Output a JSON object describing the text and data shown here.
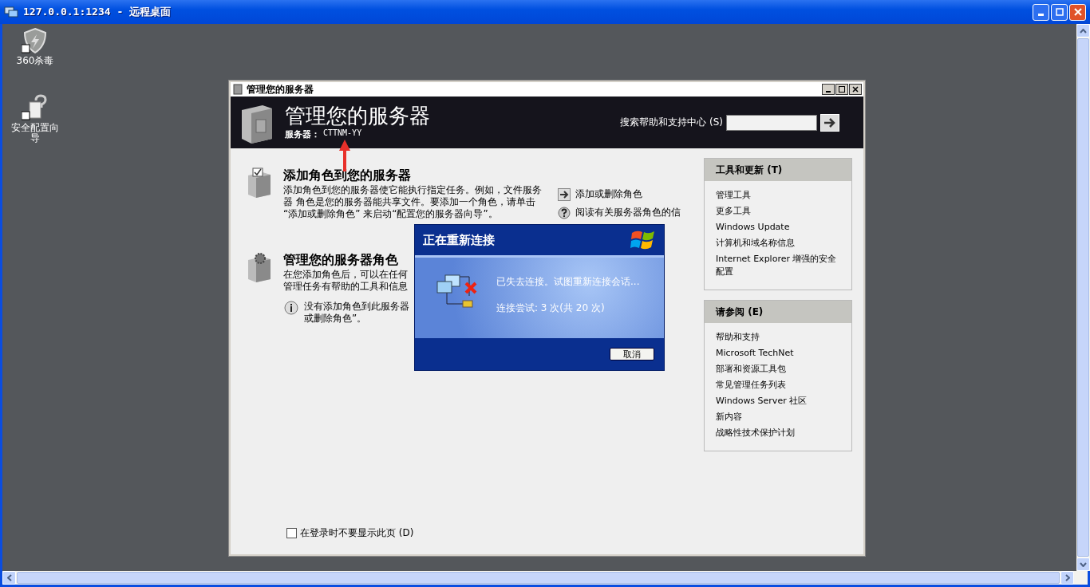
{
  "window": {
    "title": "127.0.0.1:1234 - 远程桌面"
  },
  "desktop_icons": [
    {
      "kind": "shield",
      "label": "360杀毒"
    },
    {
      "kind": "wizard",
      "label": "安全配置向导"
    }
  ],
  "server_window": {
    "title": "管理您的服务器",
    "heading": "管理您的服务器",
    "server_label": "服务器：",
    "server_name": "CTTNM-YY",
    "search_label": "搜索帮助和支持中心 (S)",
    "sections": [
      {
        "kind": "add",
        "title": "添加角色到您的服务器",
        "lines": [
          "添加角色到您的服务器使它能执行指定任务。例如，文件服务",
          "器 角色是您的服务器能共享文件。要添加一个角色，请单击",
          "“添加或删除角色” 来启动“配置您的服务器向导”。"
        ],
        "actions": [
          {
            "kind": "arrow",
            "label": "添加或删除角色"
          },
          {
            "kind": "help",
            "label": "阅读有关服务器角色的信"
          }
        ]
      },
      {
        "kind": "manage",
        "title": "管理您的服务器角色",
        "lines": [
          "在您添加角色后，可以在任何",
          "管理任务有帮助的工具和信息"
        ],
        "note": [
          "没有添加角色到此服务器",
          "或删除角色”。"
        ]
      }
    ],
    "sidebar": [
      {
        "title": "工具和更新 (T)",
        "links": [
          "管理工具",
          "更多工具",
          "Windows Update",
          "计算机和域名称信息",
          "Internet Explorer 增强的安全配置"
        ]
      },
      {
        "title": "请参阅 (E)",
        "links": [
          "帮助和支持",
          "Microsoft TechNet",
          "部署和资源工具包",
          "常见管理任务列表",
          "Windows Server 社区",
          "新内容",
          "战略性技术保护计划"
        ]
      }
    ],
    "checkbox": {
      "label": "在登录时不要显示此页 (D)",
      "checked": false
    }
  },
  "dialog": {
    "title": "正在重新连接",
    "message": "已失去连接。试图重新连接会话...",
    "attempts": "连接尝试: 3 次(共 20 次)",
    "button": "取消"
  }
}
